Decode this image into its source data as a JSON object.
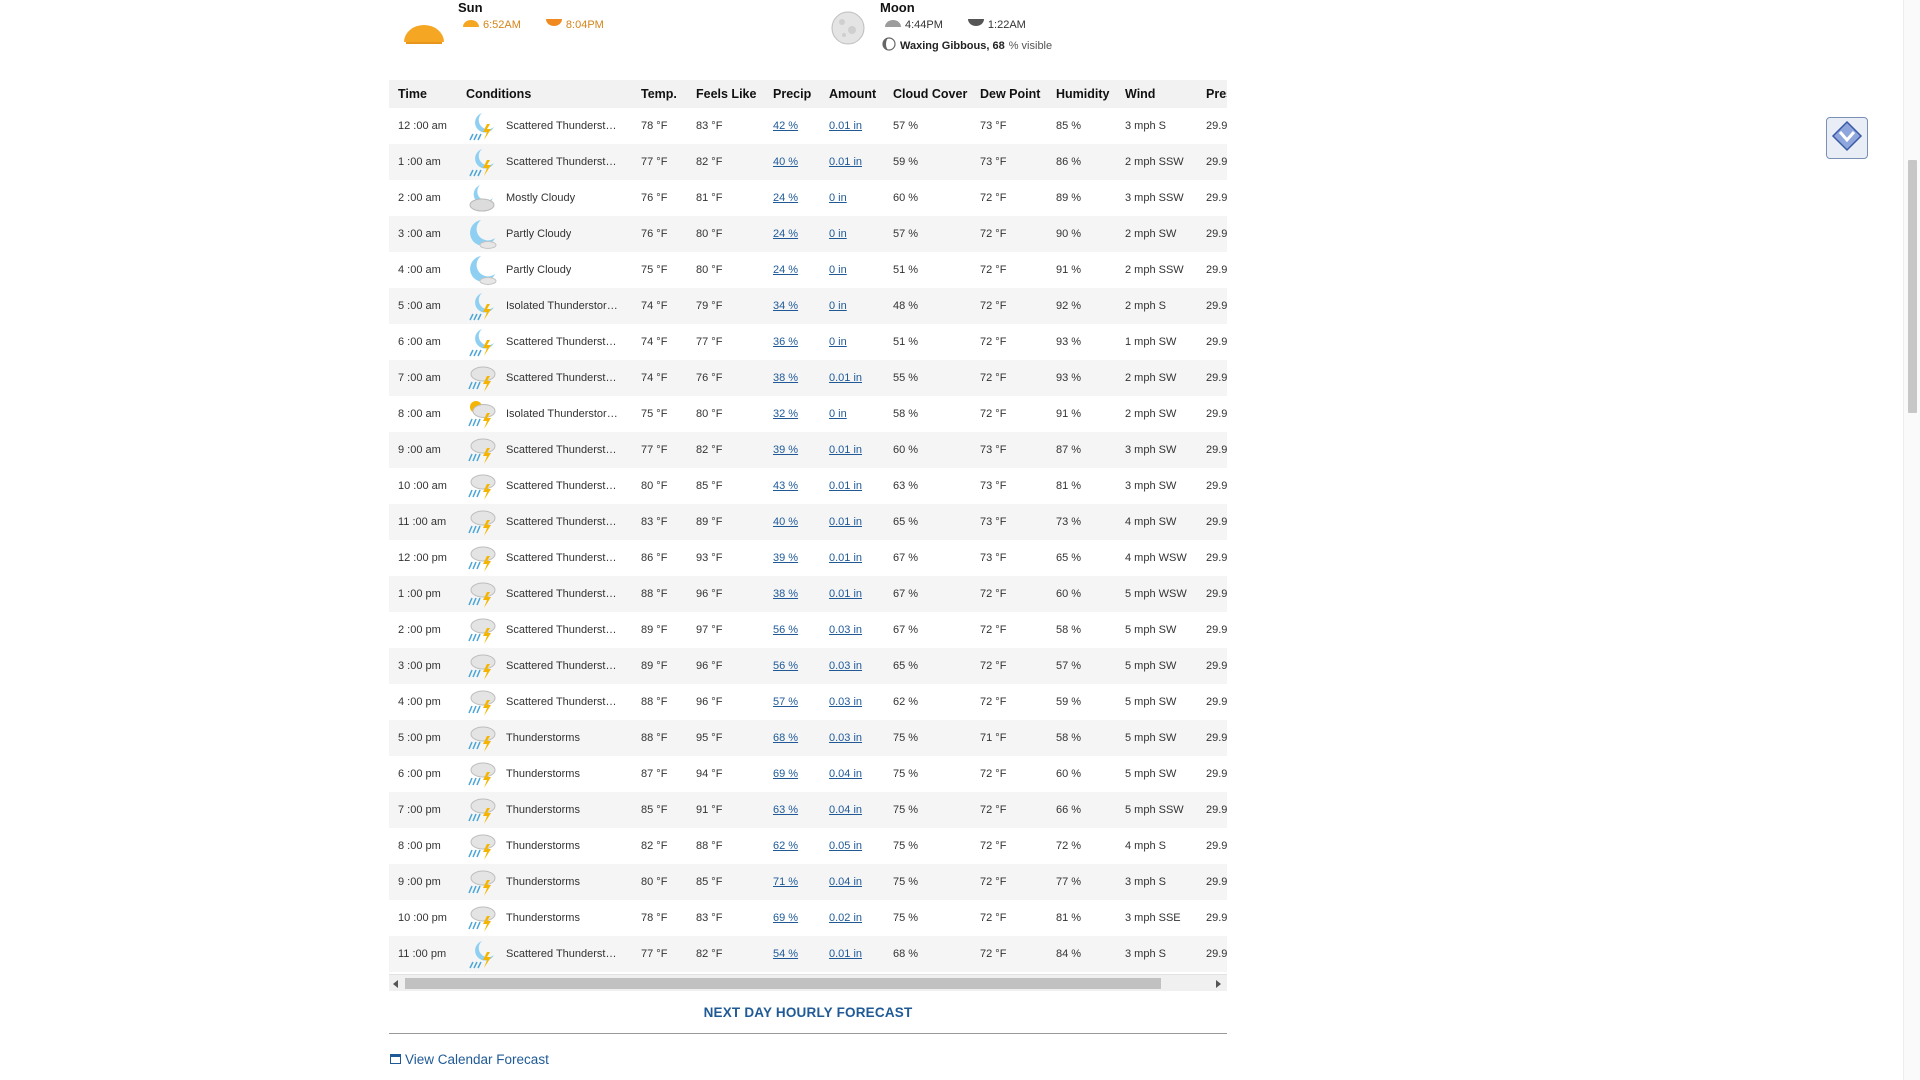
{
  "astro": {
    "sun": {
      "title": "Sun",
      "rise": "6:52AM",
      "set": "8:04PM"
    },
    "moon": {
      "title": "Moon",
      "rise": "4:44PM",
      "set": "1:22AM",
      "phase_name": "Waxing Gibbous, 68",
      "phase_suffix": "% visible"
    }
  },
  "table": {
    "headers": [
      "Time",
      "Conditions",
      "Temp.",
      "Feels Like",
      "Precip",
      "Amount",
      "Cloud Cover",
      "Dew Point",
      "Humidity",
      "Wind",
      "Pressure"
    ],
    "rows": [
      {
        "time": "12 :00 am",
        "icon": "night-storm-icon",
        "conditions": "Scattered Thunderstorms",
        "temp": "78 °F",
        "feels": "83 °F",
        "precip": "42 %",
        "amount": "0.01 in",
        "cloud": "57 %",
        "dew": "73 °F",
        "humidity": "85 %",
        "wind": "3 mph S",
        "pressure": "29.9"
      },
      {
        "time": "1 :00 am",
        "icon": "night-storm-icon",
        "conditions": "Scattered Thunderstorms",
        "temp": "77 °F",
        "feels": "82 °F",
        "precip": "40 %",
        "amount": "0.01 in",
        "cloud": "59 %",
        "dew": "73 °F",
        "humidity": "86 %",
        "wind": "2 mph SSW",
        "pressure": "29.9"
      },
      {
        "time": "2 :00 am",
        "icon": "night-cloudy-icon",
        "conditions": "Mostly Cloudy",
        "temp": "76 °F",
        "feels": "81 °F",
        "precip": "24 %",
        "amount": "0 in",
        "cloud": "60 %",
        "dew": "72 °F",
        "humidity": "89 %",
        "wind": "3 mph SSW",
        "pressure": "29.9"
      },
      {
        "time": "3 :00 am",
        "icon": "night-partly-cloudy-icon",
        "conditions": "Partly Cloudy",
        "temp": "76 °F",
        "feels": "80 °F",
        "precip": "24 %",
        "amount": "0 in",
        "cloud": "57 %",
        "dew": "72 °F",
        "humidity": "90 %",
        "wind": "2 mph SW",
        "pressure": "29.9"
      },
      {
        "time": "4 :00 am",
        "icon": "night-partly-cloudy-icon",
        "conditions": "Partly Cloudy",
        "temp": "75 °F",
        "feels": "80 °F",
        "precip": "24 %",
        "amount": "0 in",
        "cloud": "51 %",
        "dew": "72 °F",
        "humidity": "91 %",
        "wind": "2 mph SSW",
        "pressure": "29.9"
      },
      {
        "time": "5 :00 am",
        "icon": "night-storm-icon",
        "conditions": "Isolated Thunderstorms",
        "temp": "74 °F",
        "feels": "79 °F",
        "precip": "34 %",
        "amount": "0 in",
        "cloud": "48 %",
        "dew": "72 °F",
        "humidity": "92 %",
        "wind": "2 mph S",
        "pressure": "29.9"
      },
      {
        "time": "6 :00 am",
        "icon": "night-storm-icon",
        "conditions": "Scattered Thunderstorms",
        "temp": "74 °F",
        "feels": "77 °F",
        "precip": "36 %",
        "amount": "0 in",
        "cloud": "51 %",
        "dew": "72 °F",
        "humidity": "93 %",
        "wind": "1 mph SW",
        "pressure": "29.9"
      },
      {
        "time": "7 :00 am",
        "icon": "cloud-storm-icon",
        "conditions": "Scattered Thunderstorms",
        "temp": "74 °F",
        "feels": "76 °F",
        "precip": "38 %",
        "amount": "0.01 in",
        "cloud": "55 %",
        "dew": "72 °F",
        "humidity": "93 %",
        "wind": "2 mph SW",
        "pressure": "29.9"
      },
      {
        "time": "8 :00 am",
        "icon": "day-storm-icon",
        "conditions": "Isolated Thunderstorms",
        "temp": "75 °F",
        "feels": "80 °F",
        "precip": "32 %",
        "amount": "0 in",
        "cloud": "58 %",
        "dew": "72 °F",
        "humidity": "91 %",
        "wind": "2 mph SW",
        "pressure": "29.9"
      },
      {
        "time": "9 :00 am",
        "icon": "cloud-storm-icon",
        "conditions": "Scattered Thunderstorms",
        "temp": "77 °F",
        "feels": "82 °F",
        "precip": "39 %",
        "amount": "0.01 in",
        "cloud": "60 %",
        "dew": "73 °F",
        "humidity": "87 %",
        "wind": "3 mph SW",
        "pressure": "29.9"
      },
      {
        "time": "10 :00 am",
        "icon": "cloud-storm-icon",
        "conditions": "Scattered Thunderstorms",
        "temp": "80 °F",
        "feels": "85 °F",
        "precip": "43 %",
        "amount": "0.01 in",
        "cloud": "63 %",
        "dew": "73 °F",
        "humidity": "81 %",
        "wind": "3 mph SW",
        "pressure": "29.9"
      },
      {
        "time": "11 :00 am",
        "icon": "cloud-storm-icon",
        "conditions": "Scattered Thunderstorms",
        "temp": "83 °F",
        "feels": "89 °F",
        "precip": "40 %",
        "amount": "0.01 in",
        "cloud": "65 %",
        "dew": "73 °F",
        "humidity": "73 %",
        "wind": "4 mph SW",
        "pressure": "29.9"
      },
      {
        "time": "12 :00 pm",
        "icon": "cloud-storm-icon",
        "conditions": "Scattered Thunderstorms",
        "temp": "86 °F",
        "feels": "93 °F",
        "precip": "39 %",
        "amount": "0.01 in",
        "cloud": "67 %",
        "dew": "73 °F",
        "humidity": "65 %",
        "wind": "4 mph WSW",
        "pressure": "29.9"
      },
      {
        "time": "1 :00 pm",
        "icon": "cloud-storm-icon",
        "conditions": "Scattered Thunderstorms",
        "temp": "88 °F",
        "feels": "96 °F",
        "precip": "38 %",
        "amount": "0.01 in",
        "cloud": "67 %",
        "dew": "72 °F",
        "humidity": "60 %",
        "wind": "5 mph WSW",
        "pressure": "29.9"
      },
      {
        "time": "2 :00 pm",
        "icon": "cloud-storm-icon",
        "conditions": "Scattered Thunderstorms",
        "temp": "89 °F",
        "feels": "97 °F",
        "precip": "56 %",
        "amount": "0.03 in",
        "cloud": "67 %",
        "dew": "72 °F",
        "humidity": "58 %",
        "wind": "5 mph SW",
        "pressure": "29.9"
      },
      {
        "time": "3 :00 pm",
        "icon": "cloud-storm-icon",
        "conditions": "Scattered Thunderstorms",
        "temp": "89 °F",
        "feels": "96 °F",
        "precip": "56 %",
        "amount": "0.03 in",
        "cloud": "65 %",
        "dew": "72 °F",
        "humidity": "57 %",
        "wind": "5 mph SW",
        "pressure": "29.9"
      },
      {
        "time": "4 :00 pm",
        "icon": "cloud-storm-icon",
        "conditions": "Scattered Thunderstorms",
        "temp": "88 °F",
        "feels": "96 °F",
        "precip": "57 %",
        "amount": "0.03 in",
        "cloud": "62 %",
        "dew": "72 °F",
        "humidity": "59 %",
        "wind": "5 mph SW",
        "pressure": "29.9"
      },
      {
        "time": "5 :00 pm",
        "icon": "cloud-storm-icon",
        "conditions": "Thunderstorms",
        "temp": "88 °F",
        "feels": "95 °F",
        "precip": "68 %",
        "amount": "0.03 in",
        "cloud": "75 %",
        "dew": "71 °F",
        "humidity": "58 %",
        "wind": "5 mph SW",
        "pressure": "29.9"
      },
      {
        "time": "6 :00 pm",
        "icon": "cloud-storm-icon",
        "conditions": "Thunderstorms",
        "temp": "87 °F",
        "feels": "94 °F",
        "precip": "69 %",
        "amount": "0.04 in",
        "cloud": "75 %",
        "dew": "72 °F",
        "humidity": "60 %",
        "wind": "5 mph SW",
        "pressure": "29.9"
      },
      {
        "time": "7 :00 pm",
        "icon": "cloud-storm-icon",
        "conditions": "Thunderstorms",
        "temp": "85 °F",
        "feels": "91 °F",
        "precip": "63 %",
        "amount": "0.04 in",
        "cloud": "75 %",
        "dew": "72 °F",
        "humidity": "66 %",
        "wind": "5 mph SSW",
        "pressure": "29.9"
      },
      {
        "time": "8 :00 pm",
        "icon": "cloud-storm-icon",
        "conditions": "Thunderstorms",
        "temp": "82 °F",
        "feels": "88 °F",
        "precip": "62 %",
        "amount": "0.05 in",
        "cloud": "75 %",
        "dew": "72 °F",
        "humidity": "72 %",
        "wind": "4 mph S",
        "pressure": "29.9"
      },
      {
        "time": "9 :00 pm",
        "icon": "cloud-storm-icon",
        "conditions": "Thunderstorms",
        "temp": "80 °F",
        "feels": "85 °F",
        "precip": "71 %",
        "amount": "0.04 in",
        "cloud": "75 %",
        "dew": "72 °F",
        "humidity": "77 %",
        "wind": "3 mph S",
        "pressure": "29.9"
      },
      {
        "time": "10 :00 pm",
        "icon": "cloud-storm-icon",
        "conditions": "Thunderstorms",
        "temp": "78 °F",
        "feels": "83 °F",
        "precip": "69 %",
        "amount": "0.02 in",
        "cloud": "75 %",
        "dew": "72 °F",
        "humidity": "81 %",
        "wind": "3 mph SSE",
        "pressure": "29.9"
      },
      {
        "time": "11 :00 pm",
        "icon": "night-storm-icon",
        "conditions": "Scattered Thunderstorms",
        "temp": "77 °F",
        "feels": "82 °F",
        "precip": "54 %",
        "amount": "0.01 in",
        "cloud": "68 %",
        "dew": "72 °F",
        "humidity": "84 %",
        "wind": "3 mph S",
        "pressure": "29.9"
      }
    ]
  },
  "next_day_label": "NEXT DAY HOURLY FORECAST",
  "calendar_label": "View Calendar Forecast",
  "colors": {
    "link": "#1f5a97",
    "sun": "#f5a623",
    "moon": "#c9c9c9"
  }
}
